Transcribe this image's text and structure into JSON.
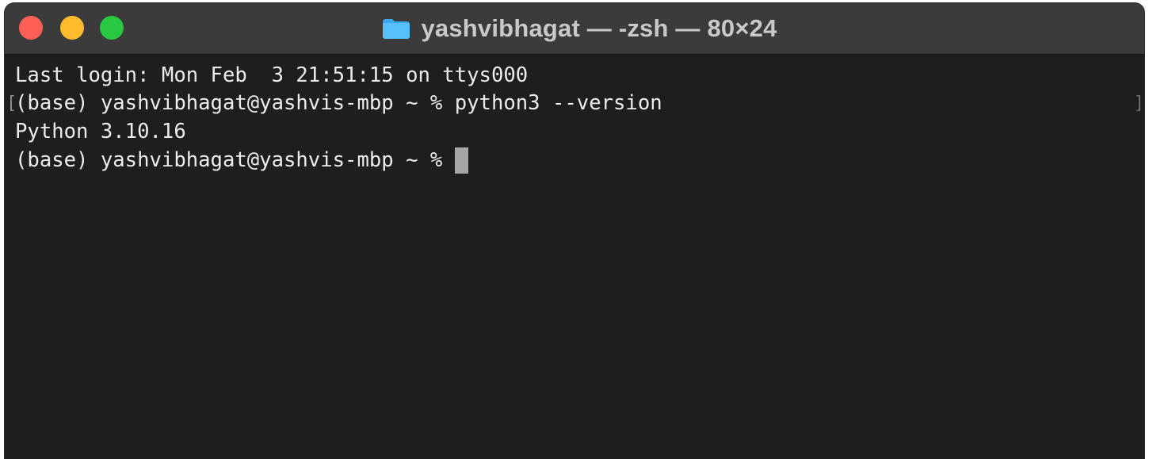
{
  "window": {
    "title": "yashvibhagat — -zsh — 80×24",
    "controls": {
      "close_color": "#fe5f57",
      "minimize_color": "#febc2e",
      "zoom_color": "#28c840"
    },
    "title_icon": "folder-icon"
  },
  "terminal": {
    "lines": [
      "Last login: Mon Feb  3 21:51:15 on ttys000",
      "(base) yashvibhagat@yashvis-mbp ~ % python3 --version",
      "Python 3.10.16",
      "(base) yashvibhagat@yashvis-mbp ~ % "
    ],
    "bracket_marker": "[",
    "right_marker": "]",
    "colors": {
      "background": "#1e1e1e",
      "text": "#ececec",
      "cursor": "#a6a6a6"
    }
  }
}
